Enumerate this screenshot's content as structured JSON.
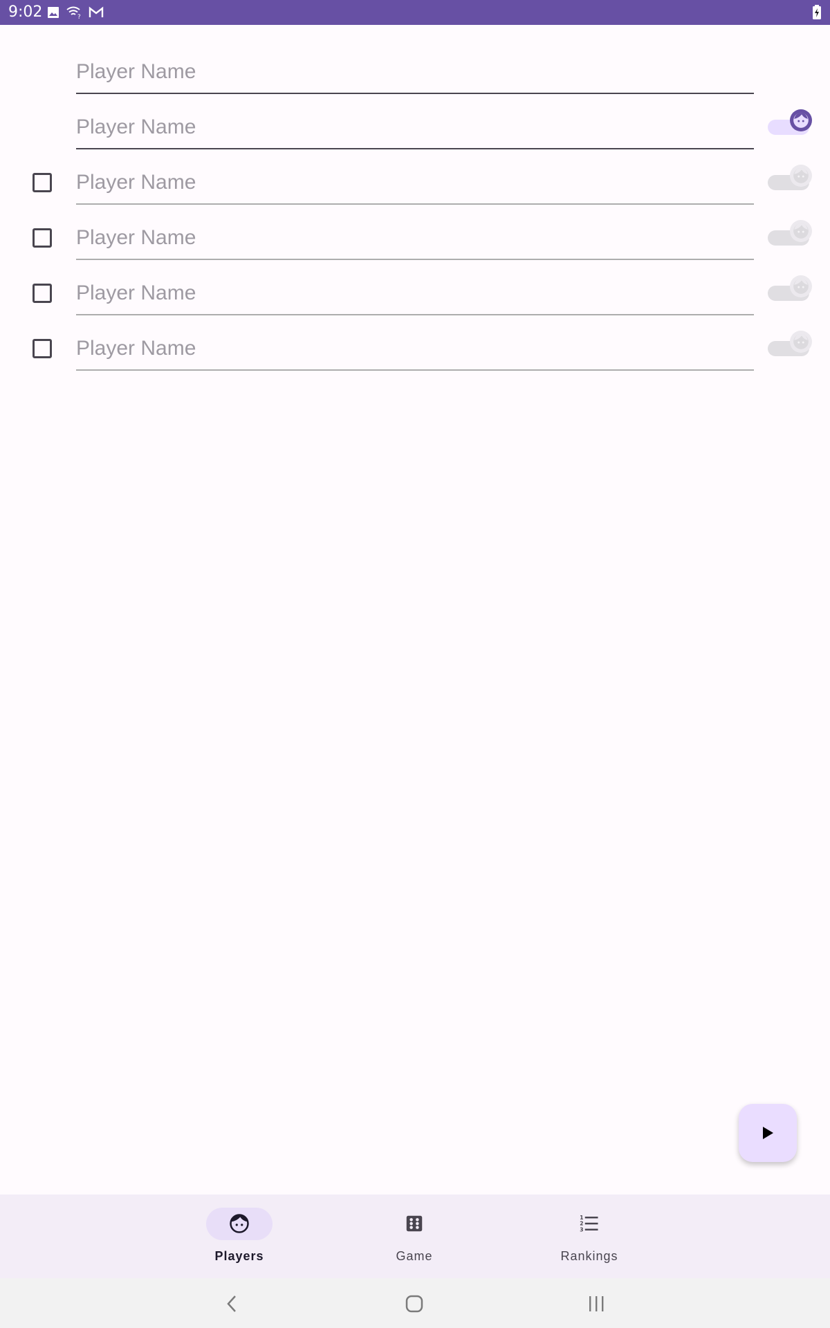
{
  "status_bar": {
    "time": "9:02",
    "icons": [
      "image-icon",
      "wifi-unknown-icon",
      "gmail-icon",
      "battery-charging-icon"
    ],
    "color": "#6750A4"
  },
  "players": {
    "rows": [
      {
        "placeholder": "Player Name",
        "value": "",
        "has_checkbox": false,
        "has_toggle": false,
        "enabled": true
      },
      {
        "placeholder": "Player Name",
        "value": "",
        "has_checkbox": false,
        "has_toggle": true,
        "toggle_on": true,
        "enabled": true
      },
      {
        "placeholder": "Player Name",
        "value": "",
        "has_checkbox": true,
        "checked": false,
        "has_toggle": true,
        "toggle_on": false,
        "enabled": false
      },
      {
        "placeholder": "Player Name",
        "value": "",
        "has_checkbox": true,
        "checked": false,
        "has_toggle": true,
        "toggle_on": false,
        "enabled": false
      },
      {
        "placeholder": "Player Name",
        "value": "",
        "has_checkbox": true,
        "checked": false,
        "has_toggle": true,
        "toggle_on": false,
        "enabled": false
      },
      {
        "placeholder": "Player Name",
        "value": "",
        "has_checkbox": true,
        "checked": false,
        "has_toggle": true,
        "toggle_on": false,
        "enabled": false
      }
    ]
  },
  "fab": {
    "icon": "play-icon",
    "color": "#EADDFF"
  },
  "bottom_nav": {
    "items": [
      {
        "label": "Players",
        "icon": "face-icon",
        "active": true
      },
      {
        "label": "Game",
        "icon": "dice-icon",
        "active": false
      },
      {
        "label": "Rankings",
        "icon": "numbered-list-icon",
        "active": false
      }
    ]
  },
  "system_nav": {
    "buttons": [
      "back",
      "home",
      "recents"
    ]
  }
}
